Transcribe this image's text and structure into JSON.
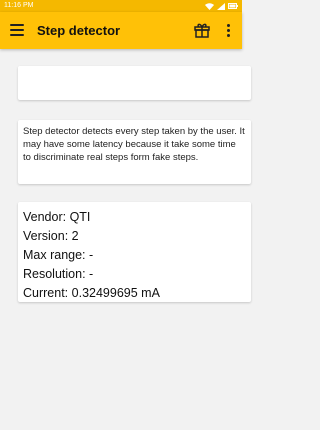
{
  "status": {
    "time": "11:16 PM"
  },
  "appbar": {
    "title": "Step detector"
  },
  "description": "Step detector detects every step taken by the user. It may have some latency because it take some time to discriminate real steps form fake steps.",
  "info": {
    "vendor_label": "Vendor:",
    "vendor_value": "QTI",
    "version_label": "Version:",
    "version_value": "2",
    "max_range_label": "Max range:",
    "max_range_value": "-",
    "resolution_label": "Resolution:",
    "resolution_value": "-",
    "current_label": "Current:",
    "current_value": "0.32499695 mA"
  },
  "colors": {
    "appbar": "#ffc107",
    "statusbar": "#f5b800",
    "background": "#f2f2f2"
  },
  "icons": [
    "menu-icon",
    "gift-icon",
    "more-vert-icon",
    "wifi-icon",
    "signal-icon",
    "battery-icon"
  ]
}
